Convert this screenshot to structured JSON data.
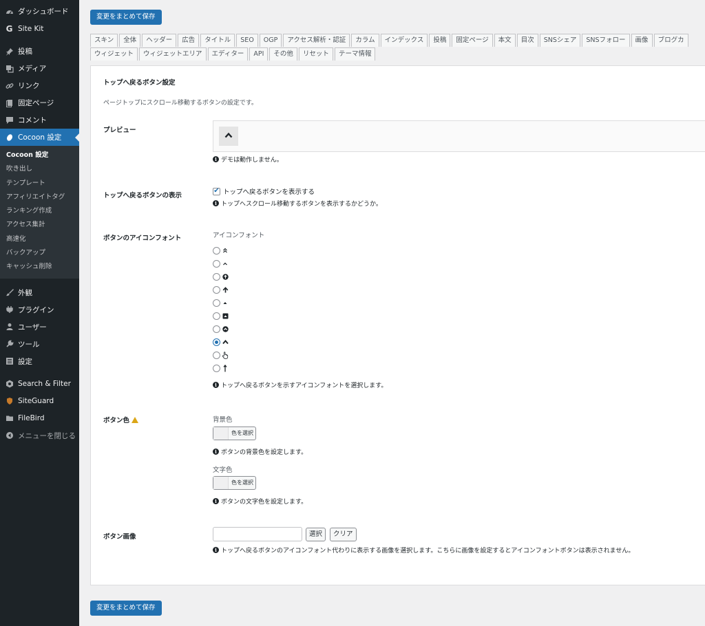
{
  "sidebar": {
    "items_top": [
      {
        "label": "ダッシュボード",
        "icon": "dashboard-icon"
      },
      {
        "label": "Site Kit",
        "icon": "google-g-icon"
      }
    ],
    "items_mid": [
      {
        "label": "投稿",
        "icon": "pin-icon"
      },
      {
        "label": "メディア",
        "icon": "media-icon"
      },
      {
        "label": "リンク",
        "icon": "link-icon"
      },
      {
        "label": "固定ページ",
        "icon": "page-icon"
      },
      {
        "label": "コメント",
        "icon": "comment-icon"
      }
    ],
    "active": {
      "label": "Cocoon 設定",
      "icon": "cocoon-icon"
    },
    "submenu": [
      "Cocoon 設定",
      "吹き出し",
      "テンプレート",
      "アフィリエイトタグ",
      "ランキング作成",
      "アクセス集計",
      "高速化",
      "バックアップ",
      "キャッシュ削除"
    ],
    "items_bottom": [
      {
        "label": "外観",
        "icon": "brush-icon"
      },
      {
        "label": "プラグイン",
        "icon": "plugin-icon"
      },
      {
        "label": "ユーザー",
        "icon": "user-icon"
      },
      {
        "label": "ツール",
        "icon": "wrench-icon"
      },
      {
        "label": "設定",
        "icon": "settings-icon"
      }
    ],
    "items_plugins": [
      {
        "label": "Search & Filter",
        "icon": "search-filter-icon"
      },
      {
        "label": "SiteGuard",
        "icon": "siteguard-icon"
      },
      {
        "label": "FileBird",
        "icon": "folder-icon"
      },
      {
        "label": "メニューを閉じる",
        "icon": "collapse-icon"
      }
    ]
  },
  "save_label": "変更をまとめて保存",
  "tabs_row1": [
    "スキン",
    "全体",
    "ヘッダー",
    "広告",
    "タイトル",
    "SEO",
    "OGP",
    "アクセス解析・認証",
    "カラム",
    "インデックス",
    "投稿",
    "固定ページ",
    "本文",
    "目次",
    "SNSシェア",
    "SNSフォロー",
    "画像",
    "ブログカ"
  ],
  "tabs_row2": [
    "ウィジェット",
    "ウィジェットエリア",
    "エディター",
    "API",
    "その他",
    "リセット",
    "テーマ情報"
  ],
  "section": {
    "title": "トップへ戻るボタン設定",
    "description": "ページトップにスクロール移動するボタンの設定です。"
  },
  "preview": {
    "label": "プレビュー",
    "note": "デモは動作しません。"
  },
  "display": {
    "label": "トップへ戻るボタンの表示",
    "checkbox_label": "トップへ戻るボタンを表示する",
    "checked": true,
    "note": "トップへスクロール移動するボタンを表示するかどうか。"
  },
  "icon_font": {
    "label": "ボタンのアイコンフォント",
    "sub_label": "アイコンフォント",
    "options": [
      "angle-double-up-icon",
      "angle-up-icon",
      "arrow-circle-up-icon",
      "arrow-up-icon",
      "caret-up-icon",
      "caret-square-up-icon",
      "chevron-circle-up-icon",
      "chevron-up-icon",
      "hand-pointer-icon",
      "long-arrow-up-icon"
    ],
    "selected_index": 7,
    "note": "トップへ戻るボタンを示すアイコンフォントを選択します。"
  },
  "button_color": {
    "label": "ボタン色",
    "bg_label": "背景色",
    "bg_button": "色を選択",
    "bg_note": "ボタンの背景色を設定します。",
    "text_label": "文字色",
    "text_button": "色を選択",
    "text_note": "ボタンの文字色を設定します。"
  },
  "button_image": {
    "label": "ボタン画像",
    "select_label": "選択",
    "clear_label": "クリア",
    "input_value": "",
    "note": "トップへ戻るボタンのアイコンフォント代わりに表示する画像を選択します。こちらに画像を設定するとアイコンフォントボタンは表示されません。"
  },
  "colors": {
    "accent": "#2271b1",
    "sidebar": "#1d2327",
    "submenu": "#2c3338",
    "warning": "#dba617"
  }
}
